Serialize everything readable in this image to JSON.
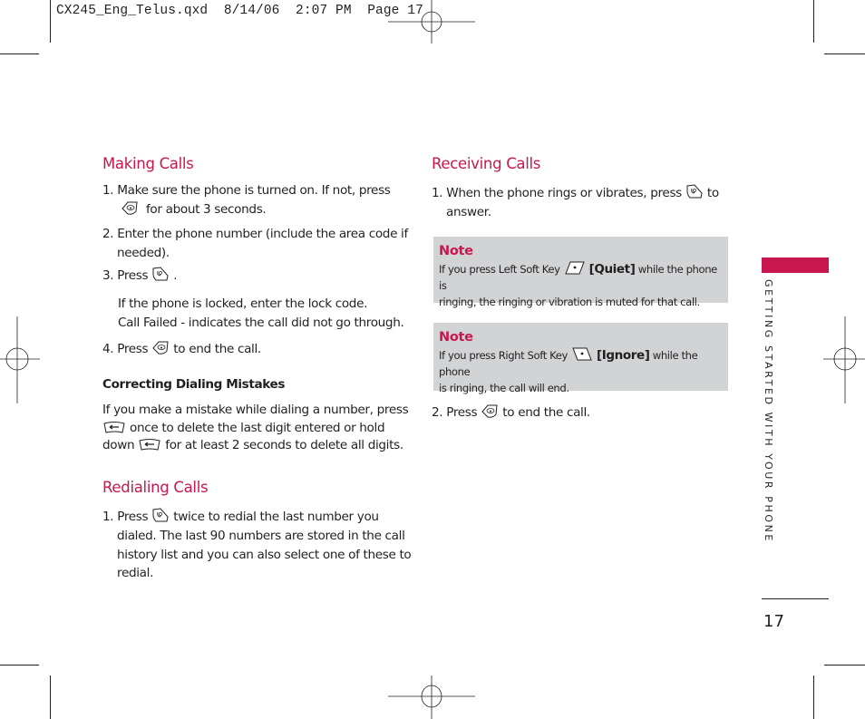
{
  "slug": {
    "text": "CX245_Eng_Telus.qxd  8/14/06  2:07 PM  Page 17"
  },
  "colors": {
    "accent": "#c8174e",
    "note_background": "#d1d3d4",
    "text": "#231f20"
  },
  "making_calls": {
    "heading": "Making Calls",
    "step1_a": "1. Make sure the phone is turned on. If not, press",
    "step1_b": "for about 3 seconds.",
    "step1_icon": "power-end-key-icon",
    "step2_a": "2. Enter the phone number (include the area code if",
    "step2_b": "needed).",
    "step3_a": "3. Press",
    "step3_b": ".",
    "step3_icon": "send-key-icon",
    "locked_text": "If the phone is locked, enter the lock code.",
    "failed_text": "Call Failed - indicates the call did not go through.",
    "step4_a": "4. Press",
    "step4_b": "to end the call.",
    "step4_icon": "power-end-key-icon"
  },
  "correcting": {
    "heading": "Correcting Dialing Mistakes",
    "line1": "If you make a mistake while dialing a number, press",
    "line2_b": "once to delete the last digit entered or hold",
    "line3_a": "down",
    "line3_b": "for at least 2 seconds to delete all digits.",
    "icon": "clear-key-icon"
  },
  "redialing": {
    "heading": "Redialing Calls",
    "step1_a": "1. Press",
    "step1_b": "twice to redial the last number you",
    "line2": "dialed. The last 90 numbers are stored in the call",
    "line3": "history list and you can also select one of these to",
    "line4": "redial.",
    "icon": "send-key-icon"
  },
  "receiving": {
    "heading": "Receiving Calls",
    "step1_a": "1. When the phone rings or vibrates, press",
    "step1_b": "to",
    "step1_c": "answer.",
    "step1_icon": "send-key-icon",
    "note1": {
      "title": "Note",
      "text_a": "If you press Left Soft Key",
      "key_label": "[Quiet]",
      "text_b": "while the phone is",
      "text_c": "ringing, the ringing or vibration is muted for that call.",
      "icon": "left-soft-key-icon"
    },
    "note2": {
      "title": "Note",
      "text_a": "If you press Right Soft Key",
      "key_label": "[Ignore]",
      "text_b": "while the phone",
      "text_c": "is ringing, the call will end.",
      "icon": "right-soft-key-icon"
    },
    "step2_a": "2. Press",
    "step2_b": "to end the call.",
    "step2_icon": "power-end-key-icon"
  },
  "sidebar": {
    "section_label": "GETTING STARTED WITH YOUR PHONE"
  },
  "footer": {
    "page_number": "17"
  }
}
